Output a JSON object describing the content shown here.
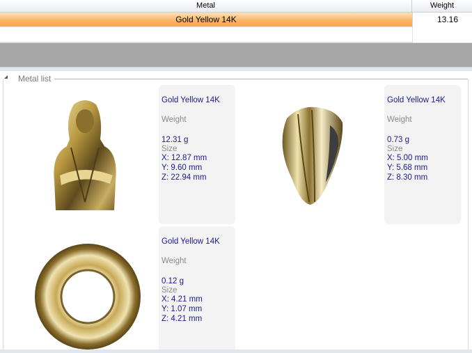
{
  "grid": {
    "columns": {
      "metal": "Metal",
      "weight": "Weight"
    },
    "rows": [
      {
        "metal": "Gold Yellow 14K",
        "weight": "13.16",
        "selected": true
      }
    ]
  },
  "metal_list": {
    "title": "Metal list",
    "items": [
      {
        "metal": "Gold Yellow 14K",
        "weight_label": "Weight",
        "weight": "12.31 g",
        "size_label": "Size",
        "x": "X: 12.87 mm",
        "y": "Y: 9.60 mm",
        "z": "Z: 22.94 mm",
        "thumbnail": "bust-figure"
      },
      {
        "metal": "Gold Yellow 14K",
        "weight_label": "Weight",
        "weight": "0.73 g",
        "size_label": "Size",
        "x": "X: 5.00 mm",
        "y": "Y: 5.68 mm",
        "z": "Z: 8.30 mm",
        "thumbnail": "fluted-bail"
      },
      {
        "metal": "Gold Yellow 14K",
        "weight_label": "Weight",
        "weight": "0.12 g",
        "size_label": "Size",
        "x": "X: 4.21 mm",
        "y": "Y: 1.07 mm",
        "z": "Z: 4.21 mm",
        "thumbnail": "jump-ring"
      }
    ]
  },
  "colors": {
    "selection": "#f8b865",
    "value_text": "#1a1a8c",
    "label_text": "#8a8a8a",
    "band": "#a6a6a6",
    "gold": "#b89a4a"
  }
}
